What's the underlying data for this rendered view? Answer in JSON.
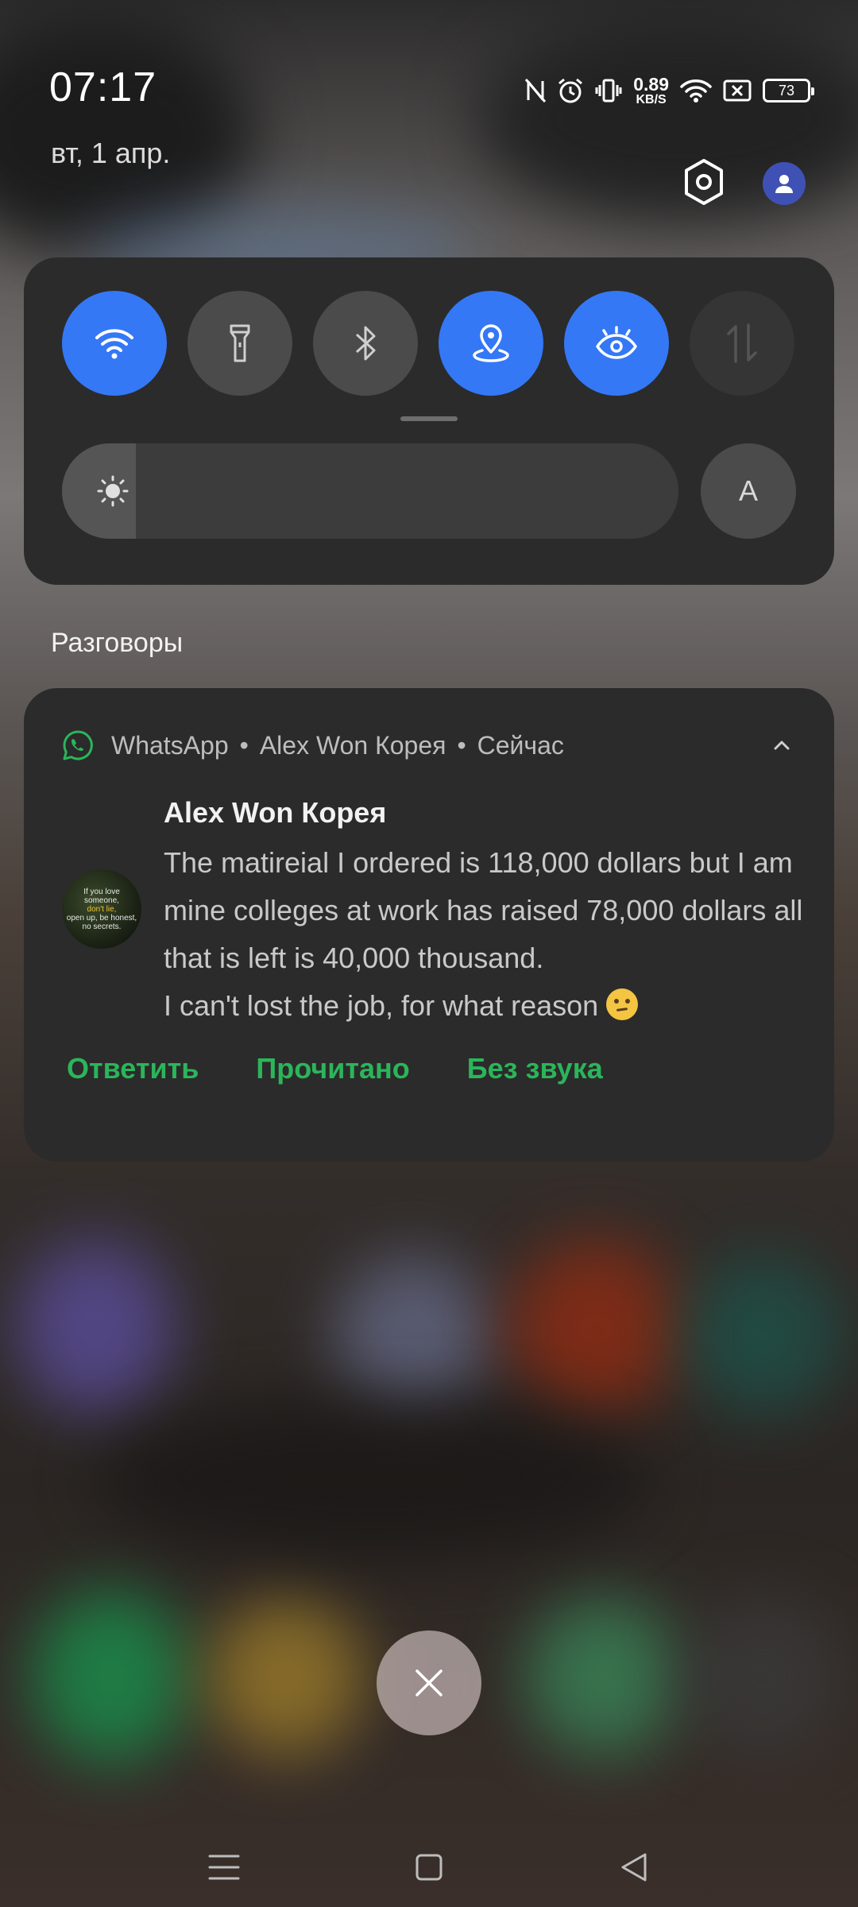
{
  "status_bar": {
    "time": "07:17",
    "net_speed_value": "0.89",
    "net_speed_unit": "KB/S",
    "battery": "73",
    "icons": [
      "nfc-off-icon",
      "alarm-icon",
      "vibrate-icon",
      "wifi-icon",
      "no-sim-icon",
      "battery-icon"
    ]
  },
  "header": {
    "date": "вт, 1 апр.",
    "settings_icon": "settings-hex-icon",
    "user_icon": "user-icon"
  },
  "quick_settings": {
    "tiles": [
      {
        "name": "wifi",
        "icon": "wifi-icon",
        "state": "on"
      },
      {
        "name": "flashlight",
        "icon": "flashlight-icon",
        "state": "off"
      },
      {
        "name": "bluetooth",
        "icon": "bluetooth-icon",
        "state": "off"
      },
      {
        "name": "location",
        "icon": "location-icon",
        "state": "on"
      },
      {
        "name": "eye-comfort",
        "icon": "eye-icon",
        "state": "on"
      },
      {
        "name": "mobile-data",
        "icon": "data-arrows-icon",
        "state": "disabled"
      }
    ],
    "brightness_level": 0.12,
    "auto_label": "A",
    "accent_color": "#3478f6"
  },
  "conversations": {
    "section_title": "Разговоры",
    "notification": {
      "app_name": "WhatsApp",
      "conversation": "Alex Won Корея",
      "time": "Сейчас",
      "sender": "Alex Won Корея",
      "message": "The matireial I ordered is 118,000 dollars but I am mine colleges at work has raised 78,000 dollars all that is left is 40,000 thousand.\nI can't lost the job, for what reason ",
      "emoji": "🤔",
      "avatar_text": [
        "If you love",
        "someone,",
        "don't lie,",
        "open up, be honest,",
        "no secrets."
      ],
      "actions": [
        "Ответить",
        "Прочитано",
        "Без звука"
      ],
      "action_color": "#2bb55a"
    }
  },
  "clear_all_icon": "close-icon",
  "nav_bar": {
    "icons": [
      "menu-icon",
      "home-icon",
      "back-icon"
    ]
  }
}
